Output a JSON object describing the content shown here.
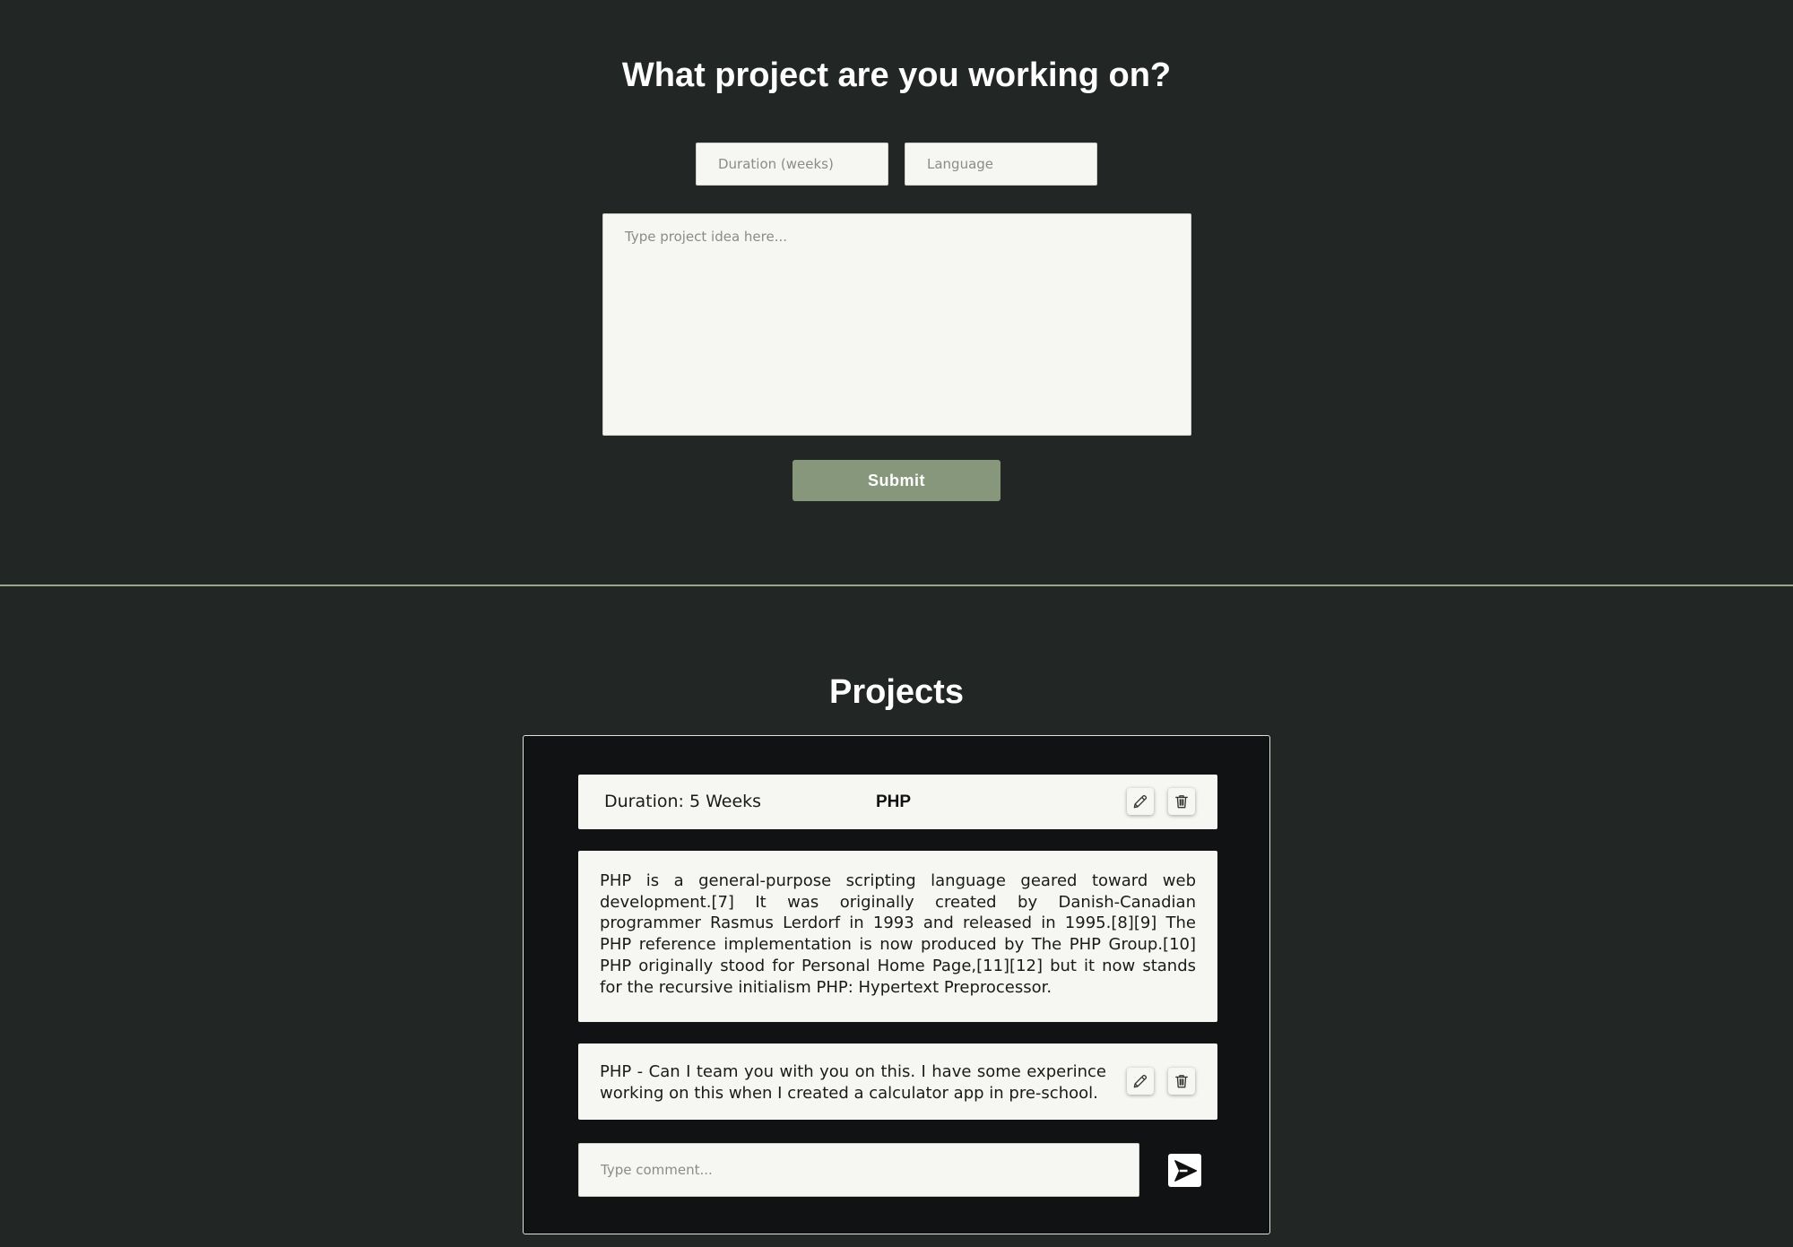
{
  "form": {
    "title": "What project are you working on?",
    "duration_placeholder": "Duration (weeks)",
    "language_placeholder": "Language",
    "idea_placeholder": "Type project idea here...",
    "submit_label": "Submit"
  },
  "projects": {
    "title": "Projects",
    "items": [
      {
        "duration": "Duration: 5 Weeks",
        "language": "PHP",
        "description": "PHP is a general-purpose scripting language geared toward web development.[7] It was originally created by Danish-Canadian programmer Rasmus Lerdorf in 1993 and released in 1995.[8][9] The PHP reference implementation is now produced by The PHP Group.[10] PHP originally stood for Personal Home Page,[11][12] but it now stands for the recursive initialism PHP: Hypertext Preprocessor.",
        "comments": [
          {
            "text": "PHP - Can I team you with you on this. I have some experince working on this when I created a calculator app in pre-school."
          }
        ],
        "comment_placeholder": "Type comment..."
      }
    ]
  },
  "icons": {
    "edit": "pencil-icon",
    "delete": "trash-icon",
    "send": "send-icon"
  },
  "colors": {
    "background": "#222625",
    "panel": "#111213",
    "card": "#f6f7f2",
    "accent": "#87977c",
    "divider": "#9aa68c"
  }
}
